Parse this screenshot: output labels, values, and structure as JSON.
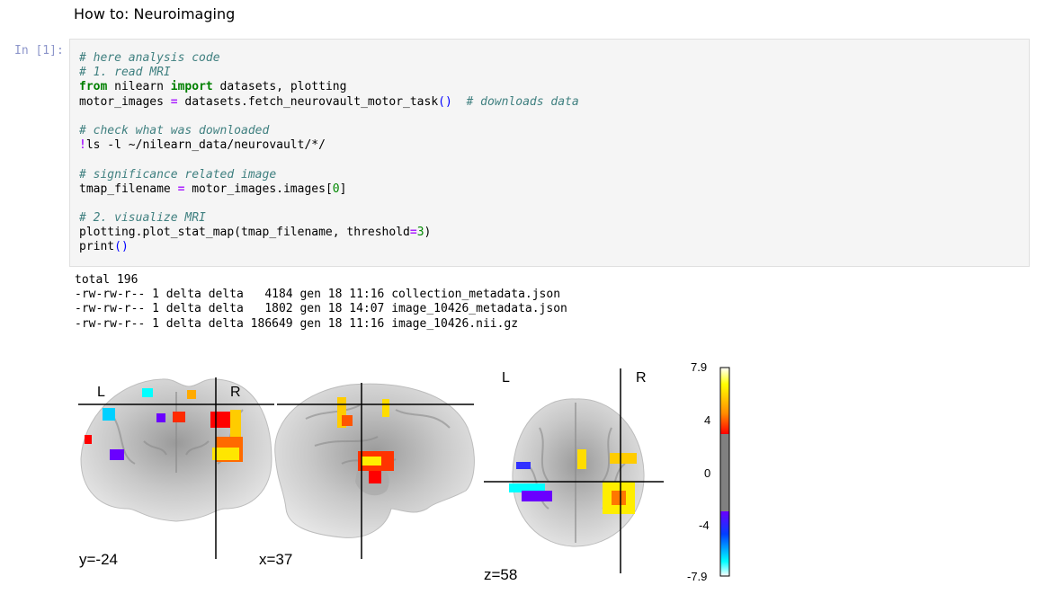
{
  "notebook": {
    "heading": "How to: Neuroimaging",
    "cell_prompt": "In [1]:"
  },
  "code_lines": [
    [
      {
        "t": "# here analysis code",
        "c": "comment"
      }
    ],
    [
      {
        "t": "# 1. read MRI",
        "c": "comment"
      }
    ],
    [
      {
        "t": "from",
        "c": "keyword"
      },
      {
        "t": " nilearn ",
        "c": ""
      },
      {
        "t": "import",
        "c": "keyword"
      },
      {
        "t": " datasets, plotting",
        "c": ""
      }
    ],
    [
      {
        "t": "motor_images ",
        "c": ""
      },
      {
        "t": "=",
        "c": "operator"
      },
      {
        "t": " datasets.fetch_neurovault_motor_task",
        "c": ""
      },
      {
        "t": "()",
        "c": "paren"
      },
      {
        "t": "  ",
        "c": ""
      },
      {
        "t": "# downloads data",
        "c": "comment"
      }
    ],
    [],
    [
      {
        "t": "# check what was downloaded",
        "c": "comment"
      }
    ],
    [
      {
        "t": "!",
        "c": "bang"
      },
      {
        "t": "ls -l ~/nilearn_data/neurovault/*/",
        "c": ""
      }
    ],
    [],
    [
      {
        "t": "# significance related image",
        "c": "comment"
      }
    ],
    [
      {
        "t": "tmap_filename ",
        "c": ""
      },
      {
        "t": "=",
        "c": "operator"
      },
      {
        "t": " motor_images.images[",
        "c": ""
      },
      {
        "t": "0",
        "c": "number"
      },
      {
        "t": "]",
        "c": ""
      }
    ],
    [],
    [
      {
        "t": "# 2. visualize MRI",
        "c": "comment"
      }
    ],
    [
      {
        "t": "plotting.plot_stat_map(tmap_filename, threshold",
        "c": ""
      },
      {
        "t": "=",
        "c": "operator"
      },
      {
        "t": "3",
        "c": "number"
      },
      {
        "t": ")",
        "c": ""
      }
    ],
    [
      {
        "t": "print",
        "c": ""
      },
      {
        "t": "()",
        "c": "paren"
      }
    ]
  ],
  "output": {
    "lines": [
      "total 196",
      "-rw-rw-r-- 1 delta delta   4184 gen 18 11:16 collection_metadata.json",
      "-rw-rw-r-- 1 delta delta   1802 gen 18 14:07 image_10426_metadata.json",
      "-rw-rw-r-- 1 delta delta 186649 gen 18 11:16 image_10426.nii.gz"
    ]
  },
  "figure": {
    "coronal": {
      "coord_label": "y=-24",
      "left_label": "L",
      "right_label": "R"
    },
    "sagittal": {
      "coord_label": "x=37"
    },
    "axial": {
      "coord_label": "z=58",
      "left_label": "L",
      "right_label": "R"
    },
    "colorbar": {
      "ticks": [
        "7.9",
        "4",
        "0",
        "-4",
        "-7.9"
      ],
      "colors": {
        "yellow": "#ffff00",
        "orange": "#ff8c00",
        "red": "#ff0000",
        "gray": "#808080",
        "violet": "#6a00ff",
        "blue": "#0040ff",
        "cyan": "#00ffff"
      }
    }
  }
}
